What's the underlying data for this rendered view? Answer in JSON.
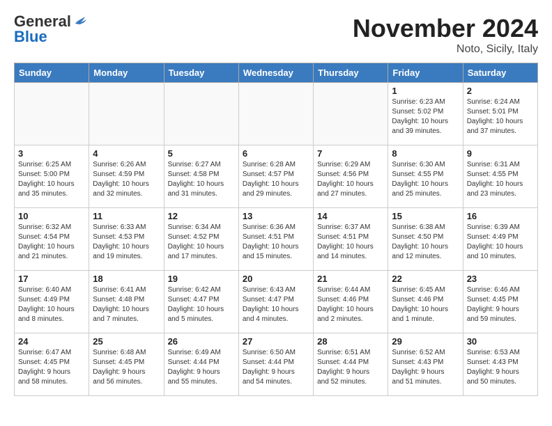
{
  "header": {
    "logo_general": "General",
    "logo_blue": "Blue",
    "month_title": "November 2024",
    "location": "Noto, Sicily, Italy"
  },
  "days_of_week": [
    "Sunday",
    "Monday",
    "Tuesday",
    "Wednesday",
    "Thursday",
    "Friday",
    "Saturday"
  ],
  "weeks": [
    [
      {
        "day": "",
        "detail": ""
      },
      {
        "day": "",
        "detail": ""
      },
      {
        "day": "",
        "detail": ""
      },
      {
        "day": "",
        "detail": ""
      },
      {
        "day": "",
        "detail": ""
      },
      {
        "day": "1",
        "detail": "Sunrise: 6:23 AM\nSunset: 5:02 PM\nDaylight: 10 hours\nand 39 minutes."
      },
      {
        "day": "2",
        "detail": "Sunrise: 6:24 AM\nSunset: 5:01 PM\nDaylight: 10 hours\nand 37 minutes."
      }
    ],
    [
      {
        "day": "3",
        "detail": "Sunrise: 6:25 AM\nSunset: 5:00 PM\nDaylight: 10 hours\nand 35 minutes."
      },
      {
        "day": "4",
        "detail": "Sunrise: 6:26 AM\nSunset: 4:59 PM\nDaylight: 10 hours\nand 32 minutes."
      },
      {
        "day": "5",
        "detail": "Sunrise: 6:27 AM\nSunset: 4:58 PM\nDaylight: 10 hours\nand 31 minutes."
      },
      {
        "day": "6",
        "detail": "Sunrise: 6:28 AM\nSunset: 4:57 PM\nDaylight: 10 hours\nand 29 minutes."
      },
      {
        "day": "7",
        "detail": "Sunrise: 6:29 AM\nSunset: 4:56 PM\nDaylight: 10 hours\nand 27 minutes."
      },
      {
        "day": "8",
        "detail": "Sunrise: 6:30 AM\nSunset: 4:55 PM\nDaylight: 10 hours\nand 25 minutes."
      },
      {
        "day": "9",
        "detail": "Sunrise: 6:31 AM\nSunset: 4:55 PM\nDaylight: 10 hours\nand 23 minutes."
      }
    ],
    [
      {
        "day": "10",
        "detail": "Sunrise: 6:32 AM\nSunset: 4:54 PM\nDaylight: 10 hours\nand 21 minutes."
      },
      {
        "day": "11",
        "detail": "Sunrise: 6:33 AM\nSunset: 4:53 PM\nDaylight: 10 hours\nand 19 minutes."
      },
      {
        "day": "12",
        "detail": "Sunrise: 6:34 AM\nSunset: 4:52 PM\nDaylight: 10 hours\nand 17 minutes."
      },
      {
        "day": "13",
        "detail": "Sunrise: 6:36 AM\nSunset: 4:51 PM\nDaylight: 10 hours\nand 15 minutes."
      },
      {
        "day": "14",
        "detail": "Sunrise: 6:37 AM\nSunset: 4:51 PM\nDaylight: 10 hours\nand 14 minutes."
      },
      {
        "day": "15",
        "detail": "Sunrise: 6:38 AM\nSunset: 4:50 PM\nDaylight: 10 hours\nand 12 minutes."
      },
      {
        "day": "16",
        "detail": "Sunrise: 6:39 AM\nSunset: 4:49 PM\nDaylight: 10 hours\nand 10 minutes."
      }
    ],
    [
      {
        "day": "17",
        "detail": "Sunrise: 6:40 AM\nSunset: 4:49 PM\nDaylight: 10 hours\nand 8 minutes."
      },
      {
        "day": "18",
        "detail": "Sunrise: 6:41 AM\nSunset: 4:48 PM\nDaylight: 10 hours\nand 7 minutes."
      },
      {
        "day": "19",
        "detail": "Sunrise: 6:42 AM\nSunset: 4:47 PM\nDaylight: 10 hours\nand 5 minutes."
      },
      {
        "day": "20",
        "detail": "Sunrise: 6:43 AM\nSunset: 4:47 PM\nDaylight: 10 hours\nand 4 minutes."
      },
      {
        "day": "21",
        "detail": "Sunrise: 6:44 AM\nSunset: 4:46 PM\nDaylight: 10 hours\nand 2 minutes."
      },
      {
        "day": "22",
        "detail": "Sunrise: 6:45 AM\nSunset: 4:46 PM\nDaylight: 10 hours\nand 1 minute."
      },
      {
        "day": "23",
        "detail": "Sunrise: 6:46 AM\nSunset: 4:45 PM\nDaylight: 9 hours\nand 59 minutes."
      }
    ],
    [
      {
        "day": "24",
        "detail": "Sunrise: 6:47 AM\nSunset: 4:45 PM\nDaylight: 9 hours\nand 58 minutes."
      },
      {
        "day": "25",
        "detail": "Sunrise: 6:48 AM\nSunset: 4:45 PM\nDaylight: 9 hours\nand 56 minutes."
      },
      {
        "day": "26",
        "detail": "Sunrise: 6:49 AM\nSunset: 4:44 PM\nDaylight: 9 hours\nand 55 minutes."
      },
      {
        "day": "27",
        "detail": "Sunrise: 6:50 AM\nSunset: 4:44 PM\nDaylight: 9 hours\nand 54 minutes."
      },
      {
        "day": "28",
        "detail": "Sunrise: 6:51 AM\nSunset: 4:44 PM\nDaylight: 9 hours\nand 52 minutes."
      },
      {
        "day": "29",
        "detail": "Sunrise: 6:52 AM\nSunset: 4:43 PM\nDaylight: 9 hours\nand 51 minutes."
      },
      {
        "day": "30",
        "detail": "Sunrise: 6:53 AM\nSunset: 4:43 PM\nDaylight: 9 hours\nand 50 minutes."
      }
    ]
  ]
}
